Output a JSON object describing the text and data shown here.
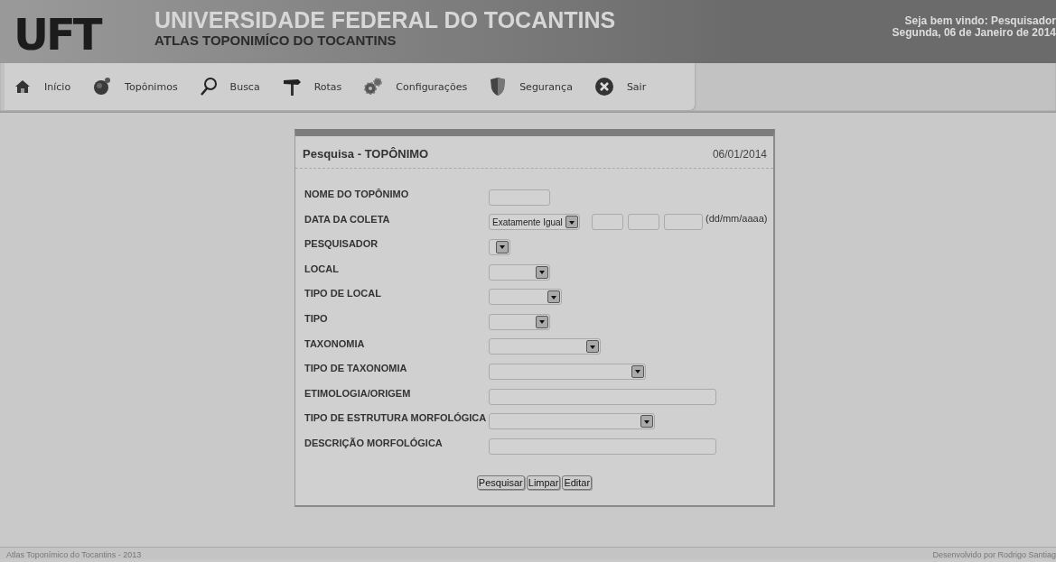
{
  "header": {
    "logo": "UFT",
    "title": "UNIVERSIDADE FEDERAL DO TOCANTINS",
    "subtitle": "ATLAS TOPONIMÍCO DO TOCANTINS",
    "welcome": "Seja bem vindo: Pesquisador",
    "date": "Segunda, 06 de Janeiro de 2014"
  },
  "menu": [
    {
      "label": "Início"
    },
    {
      "label": "Topônimos"
    },
    {
      "label": "Busca"
    },
    {
      "label": "Rotas"
    },
    {
      "label": "Configurações"
    },
    {
      "label": "Segurança"
    },
    {
      "label": "Sair"
    }
  ],
  "panel": {
    "title": "Pesquisa - TOPÔNIMO",
    "date": "06/01/2014",
    "fields": [
      {
        "label": "NOME DO TOPÔNIMO",
        "kind": "text"
      },
      {
        "label": "DATA DA COLETA",
        "kind": "date",
        "value": "Exatamente Igual",
        "hint": "(dd/mm/aaaa)"
      },
      {
        "label": "PESQUISADOR",
        "kind": "select"
      },
      {
        "label": "LOCAL",
        "kind": "select"
      },
      {
        "label": "TIPO DE LOCAL",
        "kind": "select"
      },
      {
        "label": "TIPO",
        "kind": "select"
      },
      {
        "label": "TAXONOMIA",
        "kind": "select"
      },
      {
        "label": "TIPO DE TAXONOMIA",
        "kind": "select"
      },
      {
        "label": "ETIMOLOGIA/ORIGEM",
        "kind": "text"
      },
      {
        "label": "TIPO DE ESTRUTURA MORFOLÓGICA",
        "kind": "select"
      },
      {
        "label": "DESCRIÇÃO MORFOLÓGICA",
        "kind": "text"
      }
    ],
    "buttons": [
      "Pesquisar",
      "Limpar",
      "Editar"
    ]
  },
  "footer": {
    "left": "Atlas Toponímico do Tocantins - 2013",
    "right": "Desenvolvido por Rodrigo Santiag"
  }
}
